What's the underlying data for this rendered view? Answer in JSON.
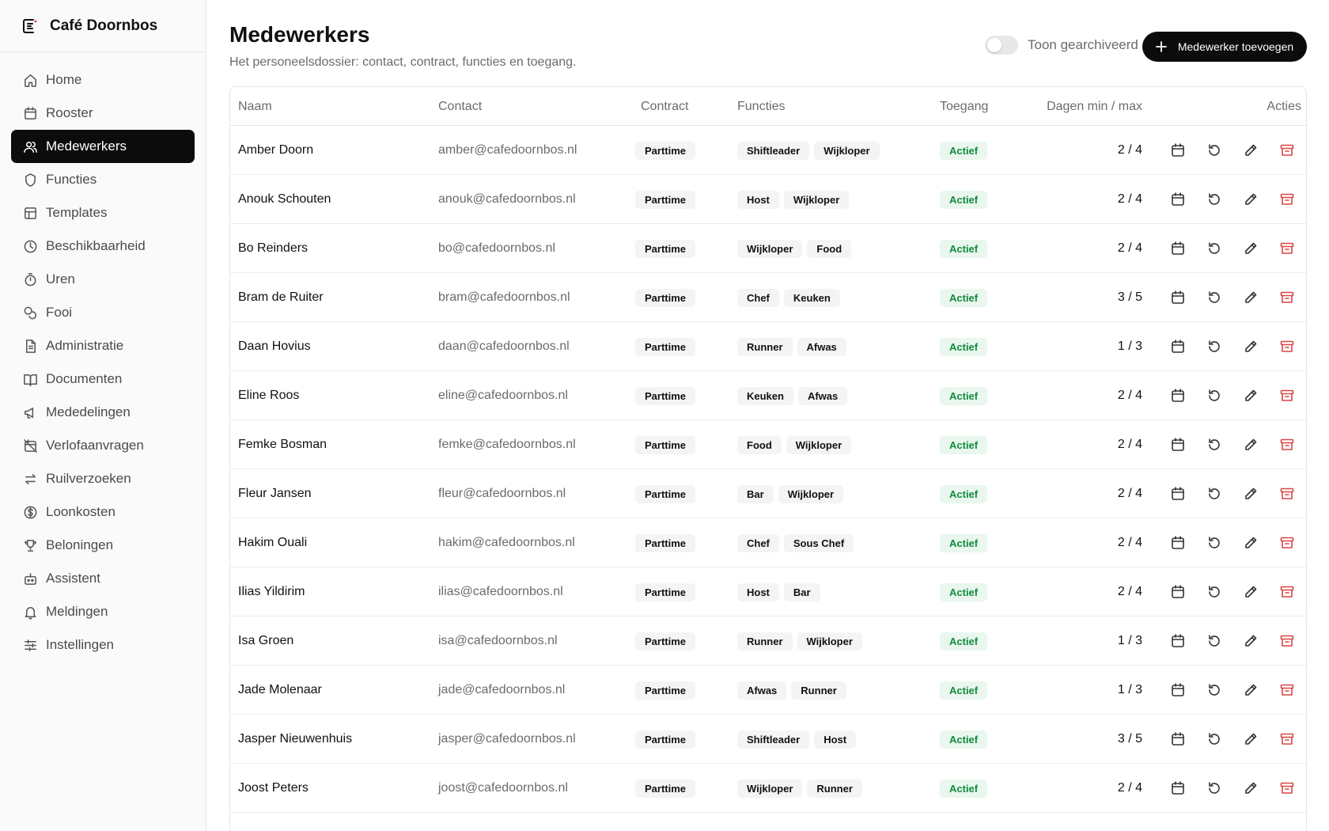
{
  "brand": {
    "name": "Café Doornbos",
    "icon": "logo-icon"
  },
  "sidebar": {
    "items": [
      {
        "label": "Home",
        "icon": "home-icon",
        "active": false
      },
      {
        "label": "Rooster",
        "icon": "calendar-icon",
        "active": false
      },
      {
        "label": "Medewerkers",
        "icon": "users-icon",
        "active": true
      },
      {
        "label": "Functies",
        "icon": "shield-icon",
        "active": false
      },
      {
        "label": "Templates",
        "icon": "layout-icon",
        "active": false
      },
      {
        "label": "Beschikbaarheid",
        "icon": "clock-icon",
        "active": false
      },
      {
        "label": "Uren",
        "icon": "timer-icon",
        "active": false
      },
      {
        "label": "Fooi",
        "icon": "coins-icon",
        "active": false
      },
      {
        "label": "Administratie",
        "icon": "file-text-icon",
        "active": false
      },
      {
        "label": "Documenten",
        "icon": "book-icon",
        "active": false
      },
      {
        "label": "Mededelingen",
        "icon": "megaphone-icon",
        "active": false
      },
      {
        "label": "Verlofaanvragen",
        "icon": "calendar-off-icon",
        "active": false
      },
      {
        "label": "Ruilverzoeken",
        "icon": "swap-icon",
        "active": false
      },
      {
        "label": "Loonkosten",
        "icon": "dollar-icon",
        "active": false
      },
      {
        "label": "Beloningen",
        "icon": "trophy-icon",
        "active": false
      },
      {
        "label": "Assistent",
        "icon": "bot-icon",
        "active": false
      },
      {
        "label": "Meldingen",
        "icon": "bell-icon",
        "active": false
      },
      {
        "label": "Instellingen",
        "icon": "sliders-icon",
        "active": false
      }
    ]
  },
  "header": {
    "title": "Medewerkers",
    "subtitle": "Het personeelsdossier: contact, contract, functies en toegang.",
    "toggle_label": "Toon gearchiveerd",
    "toggle_on": false,
    "add_label": "Medewerker toevoegen"
  },
  "table": {
    "columns": {
      "name": "Naam",
      "contact": "Contact",
      "contract": "Contract",
      "functions": "Functies",
      "access": "Toegang",
      "days": "Dagen min / max",
      "actions": "Acties"
    },
    "rows": [
      {
        "name": "Amber Doorn",
        "contact": "amber@cafedoornbos.nl",
        "contract": "Parttime",
        "functions": [
          "Shiftleader",
          "Wijkloper"
        ],
        "access": "Actief",
        "days": "2 / 4"
      },
      {
        "name": "Anouk Schouten",
        "contact": "anouk@cafedoornbos.nl",
        "contract": "Parttime",
        "functions": [
          "Host",
          "Wijkloper"
        ],
        "access": "Actief",
        "days": "2 / 4"
      },
      {
        "name": "Bo Reinders",
        "contact": "bo@cafedoornbos.nl",
        "contract": "Parttime",
        "functions": [
          "Wijkloper",
          "Food"
        ],
        "access": "Actief",
        "days": "2 / 4"
      },
      {
        "name": "Bram de Ruiter",
        "contact": "bram@cafedoornbos.nl",
        "contract": "Parttime",
        "functions": [
          "Chef",
          "Keuken"
        ],
        "access": "Actief",
        "days": "3 / 5"
      },
      {
        "name": "Daan Hovius",
        "contact": "daan@cafedoornbos.nl",
        "contract": "Parttime",
        "functions": [
          "Runner",
          "Afwas"
        ],
        "access": "Actief",
        "days": "1 / 3"
      },
      {
        "name": "Eline Roos",
        "contact": "eline@cafedoornbos.nl",
        "contract": "Parttime",
        "functions": [
          "Keuken",
          "Afwas"
        ],
        "access": "Actief",
        "days": "2 / 4"
      },
      {
        "name": "Femke Bosman",
        "contact": "femke@cafedoornbos.nl",
        "contract": "Parttime",
        "functions": [
          "Food",
          "Wijkloper"
        ],
        "access": "Actief",
        "days": "2 / 4"
      },
      {
        "name": "Fleur Jansen",
        "contact": "fleur@cafedoornbos.nl",
        "contract": "Parttime",
        "functions": [
          "Bar",
          "Wijkloper"
        ],
        "access": "Actief",
        "days": "2 / 4"
      },
      {
        "name": "Hakim Ouali",
        "contact": "hakim@cafedoornbos.nl",
        "contract": "Parttime",
        "functions": [
          "Chef",
          "Sous Chef"
        ],
        "access": "Actief",
        "days": "2 / 4"
      },
      {
        "name": "Ilias Yildirim",
        "contact": "ilias@cafedoornbos.nl",
        "contract": "Parttime",
        "functions": [
          "Host",
          "Bar"
        ],
        "access": "Actief",
        "days": "2 / 4"
      },
      {
        "name": "Isa Groen",
        "contact": "isa@cafedoornbos.nl",
        "contract": "Parttime",
        "functions": [
          "Runner",
          "Wijkloper"
        ],
        "access": "Actief",
        "days": "1 / 3"
      },
      {
        "name": "Jade Molenaar",
        "contact": "jade@cafedoornbos.nl",
        "contract": "Parttime",
        "functions": [
          "Afwas",
          "Runner"
        ],
        "access": "Actief",
        "days": "1 / 3"
      },
      {
        "name": "Jasper Nieuwenhuis",
        "contact": "jasper@cafedoornbos.nl",
        "contract": "Parttime",
        "functions": [
          "Shiftleader",
          "Host"
        ],
        "access": "Actief",
        "days": "3 / 5"
      },
      {
        "name": "Joost Peters",
        "contact": "joost@cafedoornbos.nl",
        "contract": "Parttime",
        "functions": [
          "Wijkloper",
          "Runner"
        ],
        "access": "Actief",
        "days": "2 / 4"
      }
    ],
    "row_actions": [
      "calendar-icon",
      "reset-icon",
      "edit-icon",
      "archive-icon"
    ]
  },
  "colors": {
    "accent": "#0c0c0c",
    "active_badge_bg": "#e9f7ee",
    "active_badge_text": "#138a3e",
    "archive_icon": "#d94646"
  }
}
